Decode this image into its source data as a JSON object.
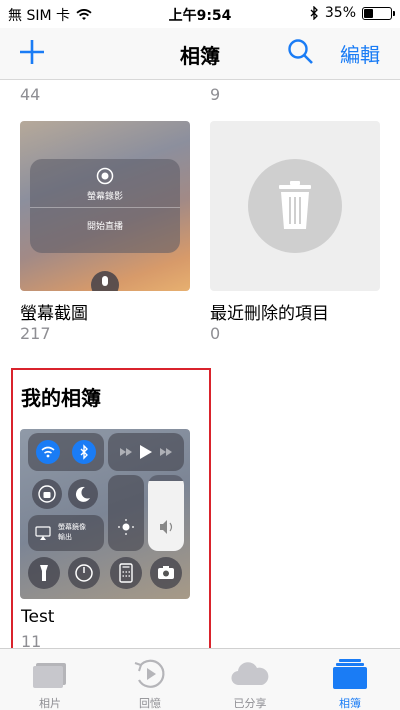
{
  "status_bar": {
    "carrier": "無 SIM 卡",
    "time": "上午9:54",
    "battery_label": "35%",
    "battery_level": 0.35
  },
  "nav": {
    "title": "相簿",
    "edit_label": "編輯"
  },
  "top_row_counts": [
    "44",
    "9"
  ],
  "albums": [
    {
      "title": "螢幕截圖",
      "count": "217",
      "thumb_texts": [
        "螢幕錄影",
        "開始直播"
      ]
    },
    {
      "title": "最近刪除的項目",
      "count": "0"
    }
  ],
  "my_albums": {
    "section_title": "我的相簿",
    "items": [
      {
        "title": "Test",
        "count": "11",
        "thumb_texts": [
          "螢幕鏡像",
          "輸出"
        ]
      }
    ]
  },
  "tabs": [
    {
      "label": "相片",
      "icon": "photos-icon"
    },
    {
      "label": "回憶",
      "icon": "memories-icon"
    },
    {
      "label": "已分享",
      "icon": "shared-icon"
    },
    {
      "label": "相簿",
      "icon": "albums-icon"
    }
  ],
  "colors": {
    "accent": "#1a7cf5",
    "highlight_box": "#d9232c",
    "secondary_text": "#8e8e93"
  }
}
